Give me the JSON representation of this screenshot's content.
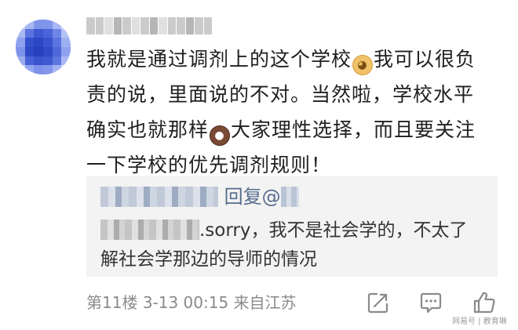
{
  "comment": {
    "line1a": "我就是通过调剂上的这个学校",
    "emoji1": "doge-emoji",
    "line1b": "我可以很负",
    "line2": "责的说，里面说的不对。当然啦，学校水平",
    "line3a": "确实也就那样",
    "emoji2": "shocked-emoji",
    "line3b": "大家理性选择，而且要关注",
    "line4": "一下学校的优先调剂规则！"
  },
  "reply": {
    "reply_label": "回复@",
    "line1_text": ".sorry，我不是社会学的，不太了",
    "line2_text": "解社会学那边的导师的情况"
  },
  "meta": {
    "floor": "第11楼",
    "time": "3-13 00:15",
    "source": "来自江苏"
  },
  "actions": {
    "icons": [
      "share-icon",
      "comment-icon",
      "like-icon"
    ]
  },
  "watermark": {
    "text": "网易号 | 教育琳"
  },
  "colors": {
    "reply_bg": "#f3f3f3",
    "link": "#556b8d",
    "meta": "#8a8a8a",
    "avatar": "#6f86e8"
  }
}
